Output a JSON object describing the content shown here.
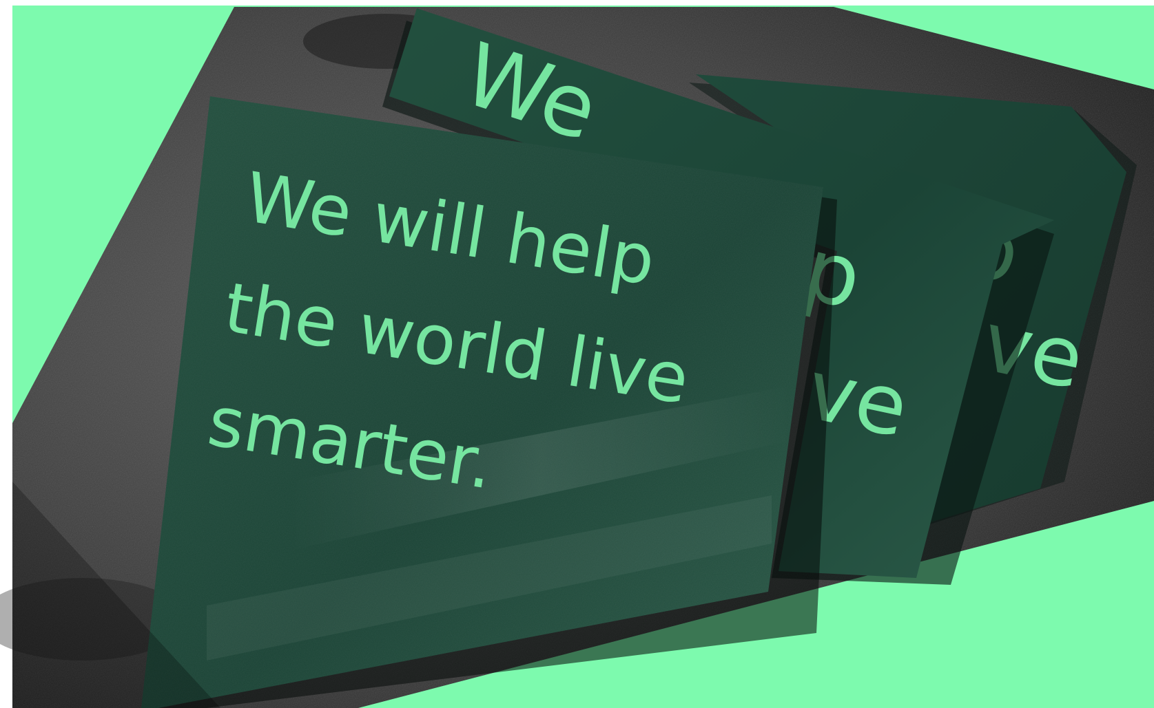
{
  "headline": {
    "line1": "We will help",
    "line2": "the world live",
    "line3": "smarter."
  },
  "back_card_fragments": {
    "card2_top": "We",
    "card2_mid": "p",
    "card2_low": "ve",
    "card3_top": "lp",
    "card3_low": "ve"
  },
  "colors": {
    "accent_green": "#7DFAAE",
    "card_green": "#1E4A3C",
    "card_text_green": "#76E5A0",
    "backdrop_gray": "#3E3E3E",
    "page_white": "#FFFFFF"
  }
}
